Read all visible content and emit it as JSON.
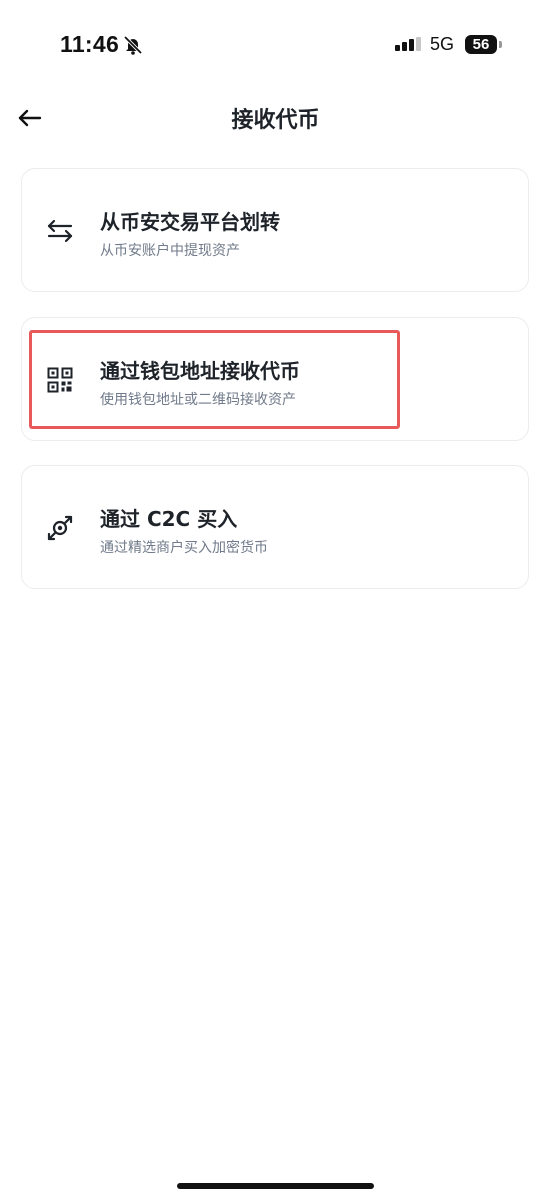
{
  "status_bar": {
    "time": "11:46",
    "network": "5G",
    "battery": "56"
  },
  "header": {
    "title": "接收代币"
  },
  "options": [
    {
      "title": "从币安交易平台划转",
      "subtitle": "从币安账户中提现资产",
      "icon": "transfer-arrows-icon"
    },
    {
      "title": "通过钱包地址接收代币",
      "subtitle": "使用钱包地址或二维码接收资产",
      "icon": "qr-code-icon"
    },
    {
      "title": "通过 C2C 买入",
      "subtitle": "通过精选商户买入加密货币",
      "icon": "c2c-exchange-icon"
    }
  ],
  "colors": {
    "highlight": "#e85a5a",
    "text": "#1e2329",
    "subtext": "#707a8a",
    "card_border": "#eaecef"
  }
}
